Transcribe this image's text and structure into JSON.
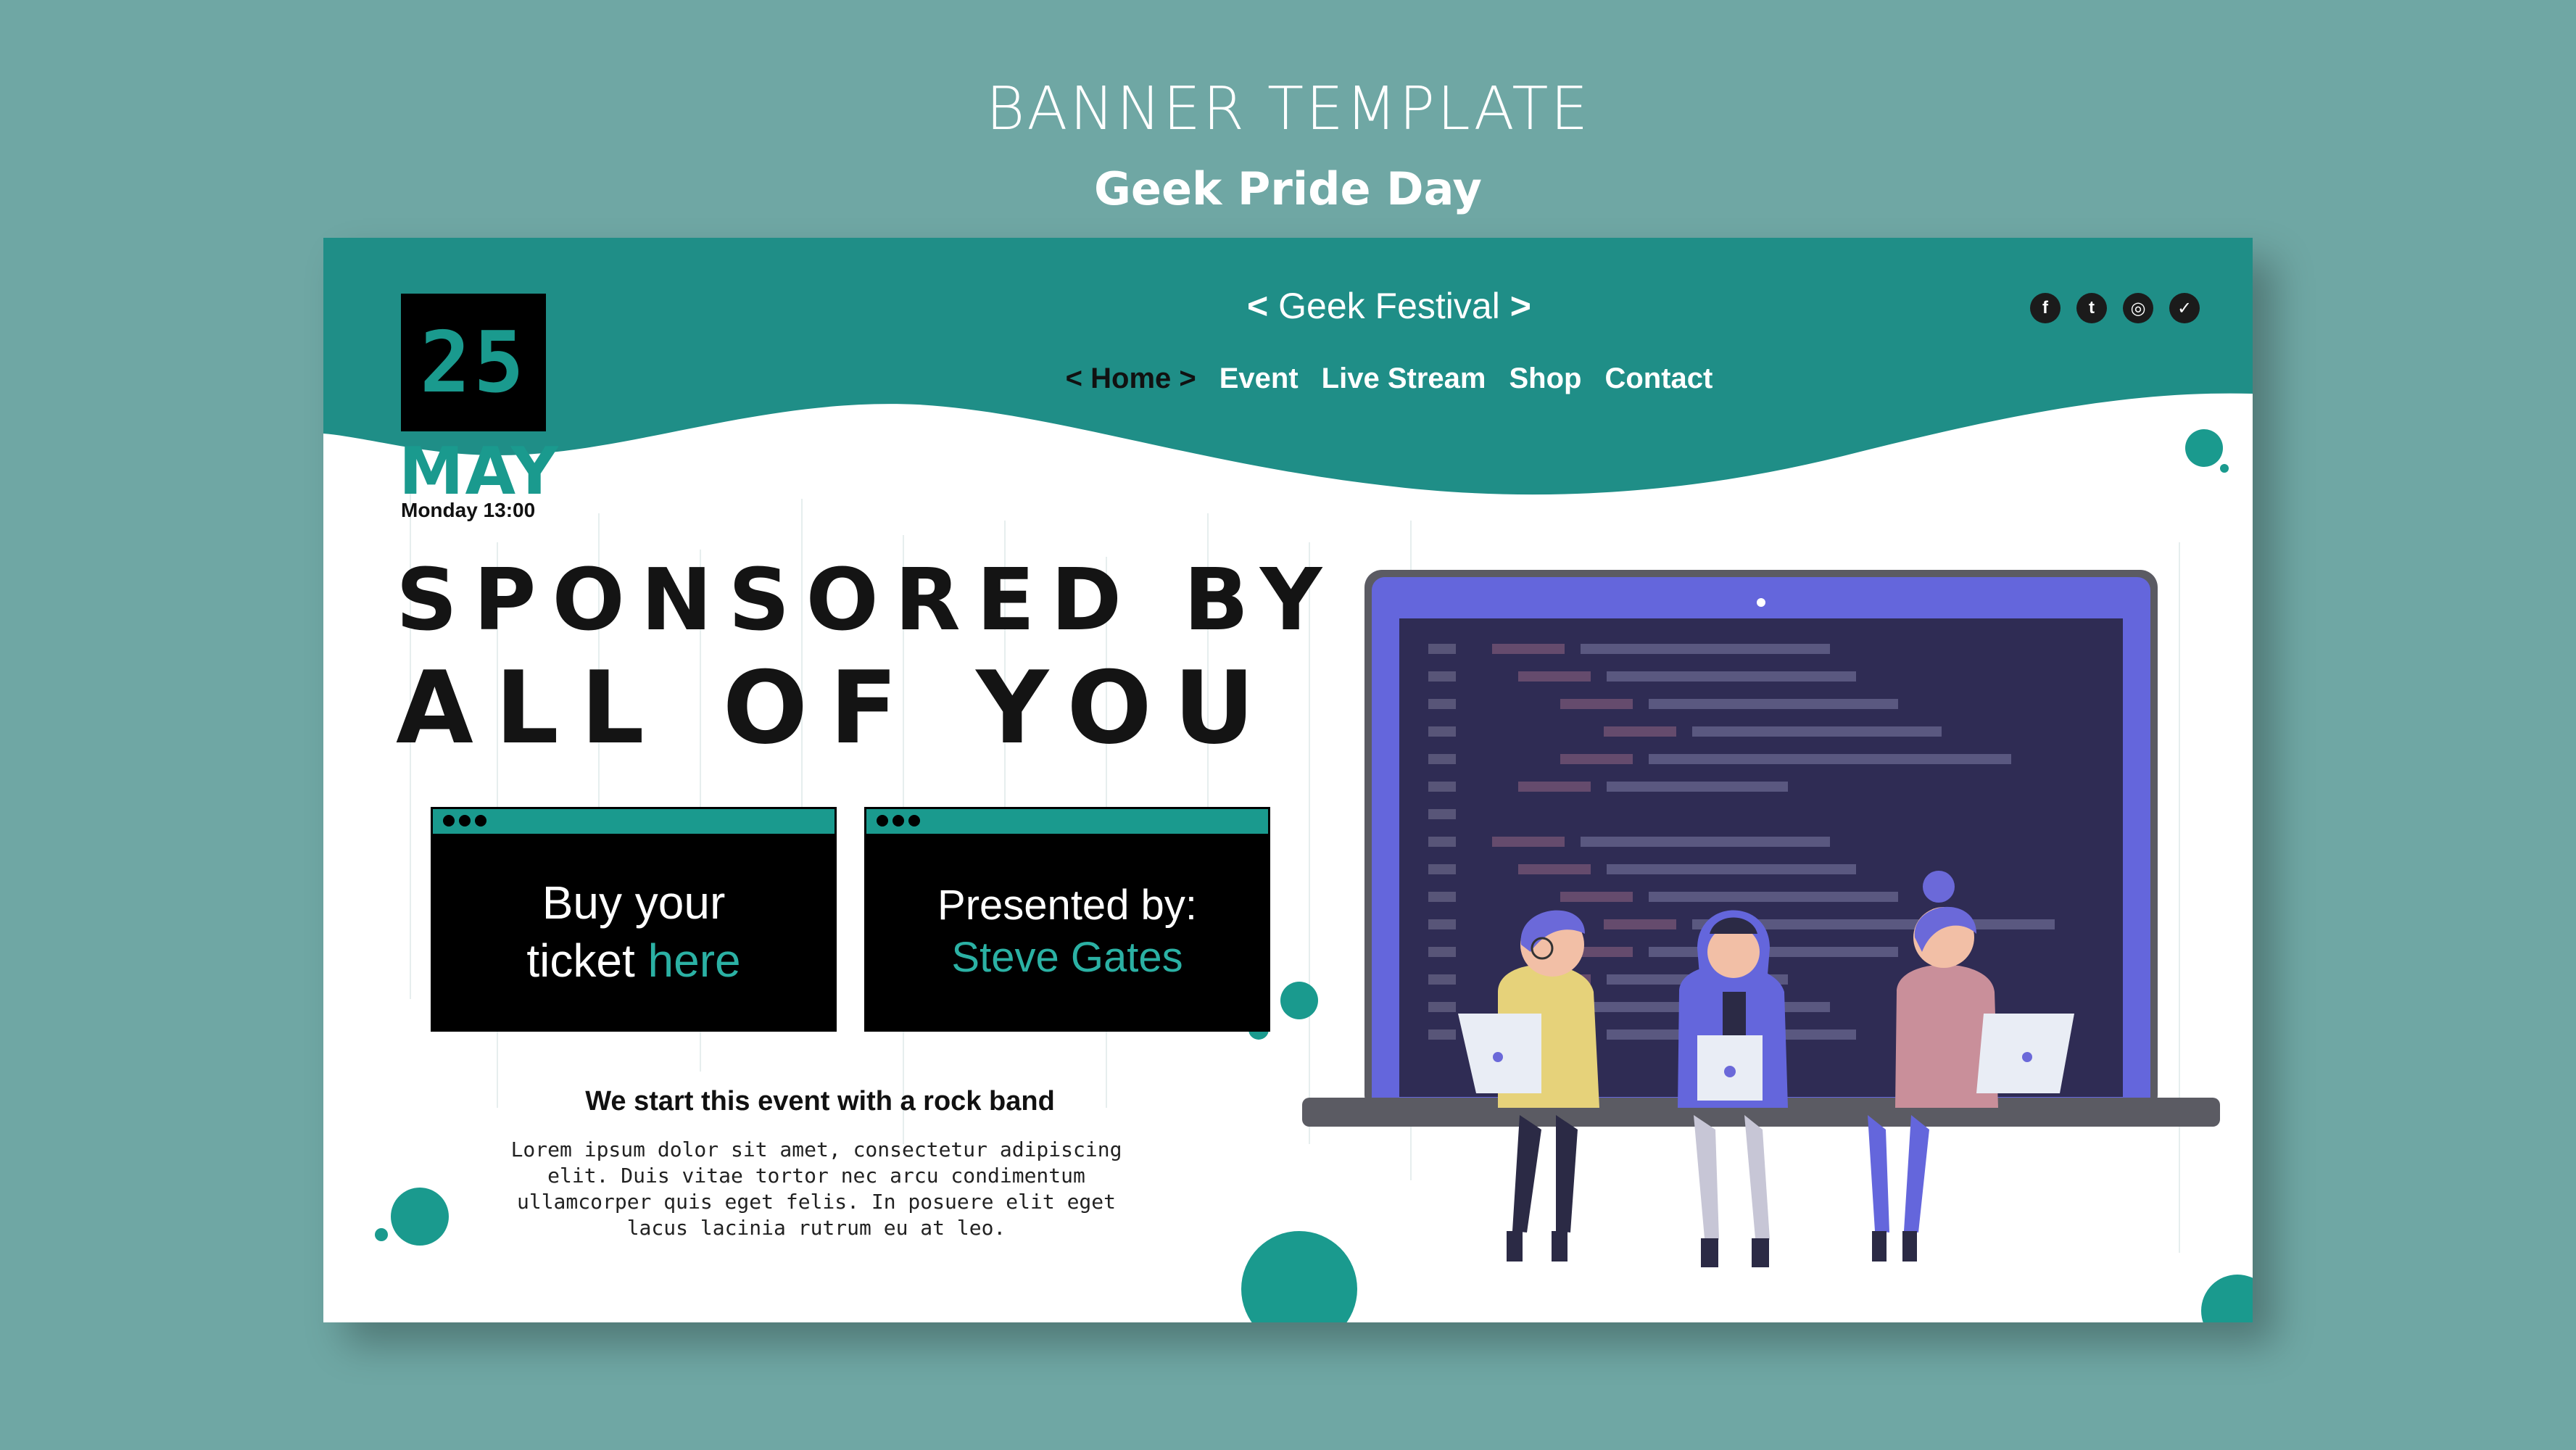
{
  "page": {
    "title": "BANNER TEMPLATE",
    "subtitle": "Geek Pride Day"
  },
  "banner": {
    "date": {
      "day": "25",
      "month": "MAY",
      "time": "Monday 13:00"
    },
    "festival": {
      "left": "<",
      "name": "Geek Festival",
      "right": ">"
    },
    "nav": [
      {
        "label": "< Home >",
        "active": true
      },
      {
        "label": "Event"
      },
      {
        "label": "Live Stream"
      },
      {
        "label": "Shop"
      },
      {
        "label": "Contact"
      }
    ],
    "social": [
      {
        "icon": "facebook-icon",
        "glyph": "f"
      },
      {
        "icon": "tumblr-icon",
        "glyph": "t"
      },
      {
        "icon": "instagram-icon",
        "glyph": "◎"
      },
      {
        "icon": "twitter-icon",
        "glyph": "✓"
      }
    ],
    "headline": {
      "line1": "SPONSORED BY",
      "line2": "ALL OF YOU"
    },
    "ticket_card": {
      "line1": "Buy your",
      "line2_prefix": "ticket",
      "line2_link": "here"
    },
    "presenter_card": {
      "line1": "Presented by:",
      "name": "Steve Gates"
    },
    "subhead": "We start this event with a rock band",
    "lorem": "Lorem ipsum dolor sit amet, consectetur adipiscing elit. Duis vitae tortor nec arcu condimentum ullamcorper quis eget felis. In posuere elit eget lacus lacinia rutrum eu at leo."
  },
  "colors": {
    "background": "#6fa7a4",
    "teal": "#1f8e87",
    "accent": "#1a9a8e",
    "laptop_screen": "#2e2c52",
    "laptop_frame": "#6b69d9"
  }
}
